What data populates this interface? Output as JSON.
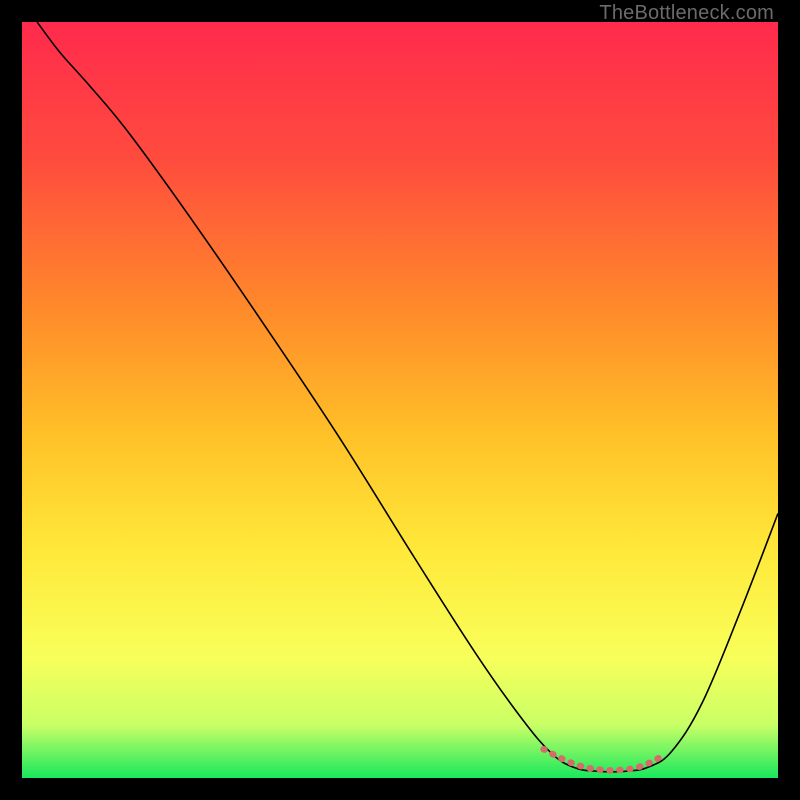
{
  "watermark": "TheBottleneck.com",
  "chart_data": {
    "type": "line",
    "title": "",
    "xlabel": "",
    "ylabel": "",
    "xlim": [
      0,
      100
    ],
    "ylim": [
      0,
      100
    ],
    "gradient_stops": [
      {
        "offset": 0,
        "color": "#ff2a4d"
      },
      {
        "offset": 18,
        "color": "#ff4b3e"
      },
      {
        "offset": 38,
        "color": "#ff8a2a"
      },
      {
        "offset": 55,
        "color": "#ffc228"
      },
      {
        "offset": 70,
        "color": "#ffe93a"
      },
      {
        "offset": 84,
        "color": "#f8ff5a"
      },
      {
        "offset": 93,
        "color": "#c9ff66"
      },
      {
        "offset": 100,
        "color": "#18e85e"
      }
    ],
    "series": [
      {
        "name": "bottleneck-curve",
        "color": "#000000",
        "width": 1.6,
        "points": [
          {
            "x": 2.0,
            "y": 100.0
          },
          {
            "x": 5.0,
            "y": 96.0
          },
          {
            "x": 9.0,
            "y": 91.5
          },
          {
            "x": 14.0,
            "y": 85.5
          },
          {
            "x": 22.0,
            "y": 74.5
          },
          {
            "x": 32.0,
            "y": 60.0
          },
          {
            "x": 42.0,
            "y": 45.0
          },
          {
            "x": 52.0,
            "y": 29.0
          },
          {
            "x": 60.0,
            "y": 16.5
          },
          {
            "x": 66.0,
            "y": 8.0
          },
          {
            "x": 70.0,
            "y": 3.3
          },
          {
            "x": 73.0,
            "y": 1.4
          },
          {
            "x": 76.0,
            "y": 0.9
          },
          {
            "x": 80.0,
            "y": 0.9
          },
          {
            "x": 83.0,
            "y": 1.5
          },
          {
            "x": 86.0,
            "y": 3.6
          },
          {
            "x": 90.0,
            "y": 10.0
          },
          {
            "x": 95.0,
            "y": 22.0
          },
          {
            "x": 100.0,
            "y": 35.0
          }
        ]
      },
      {
        "name": "highlight-segment",
        "color": "#d76a6a",
        "width": 6.5,
        "dash": [
          1,
          9
        ],
        "points": [
          {
            "x": 69.0,
            "y": 3.8
          },
          {
            "x": 70.5,
            "y": 3.0
          },
          {
            "x": 72.0,
            "y": 2.3
          },
          {
            "x": 73.5,
            "y": 1.7
          },
          {
            "x": 75.0,
            "y": 1.3
          },
          {
            "x": 76.5,
            "y": 1.1
          },
          {
            "x": 78.0,
            "y": 1.0
          },
          {
            "x": 79.5,
            "y": 1.1
          },
          {
            "x": 81.0,
            "y": 1.3
          },
          {
            "x": 82.5,
            "y": 1.8
          },
          {
            "x": 84.0,
            "y": 2.5
          },
          {
            "x": 85.0,
            "y": 3.3
          }
        ]
      }
    ]
  }
}
